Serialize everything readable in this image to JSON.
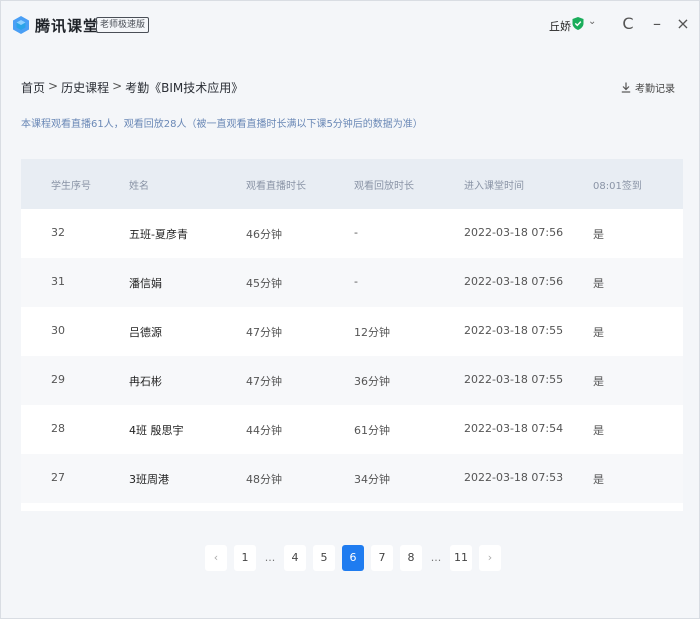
{
  "app": {
    "name": "腾讯课堂",
    "edition_badge": "老师极速版",
    "user_name": "丘娇",
    "user_chevron": "⌄",
    "refresh_glyph": "C",
    "minimize_glyph": "–",
    "close_glyph": "×"
  },
  "breadcrumb": {
    "items": [
      "首页",
      "历史课程",
      "考勤《BIM技术应用》"
    ],
    "separator": ">"
  },
  "export_label": "考勤记录",
  "summary": "本课程观看直播61人，观看回放28人（被一直观看直播时长满以下课5分钟后的数据为准）",
  "table": {
    "columns": [
      "学生序号",
      "姓名",
      "观看直播时长",
      "观看回放时长",
      "进入课堂时间",
      "08:01签到"
    ],
    "rows": [
      {
        "id": "32",
        "name": "五班-夏彦青",
        "live": "46分钟",
        "replay": "-",
        "enter": "2022-03-18 07:56",
        "signed": "是"
      },
      {
        "id": "31",
        "name": "潘信娟",
        "live": "45分钟",
        "replay": "-",
        "enter": "2022-03-18 07:56",
        "signed": "是"
      },
      {
        "id": "30",
        "name": "吕德源",
        "live": "47分钟",
        "replay": "12分钟",
        "enter": "2022-03-18 07:55",
        "signed": "是"
      },
      {
        "id": "29",
        "name": "冉石彬",
        "live": "47分钟",
        "replay": "36分钟",
        "enter": "2022-03-18 07:55",
        "signed": "是"
      },
      {
        "id": "28",
        "name": "4班 殷思宇",
        "live": "44分钟",
        "replay": "61分钟",
        "enter": "2022-03-18 07:54",
        "signed": "是"
      },
      {
        "id": "27",
        "name": "3班周港",
        "live": "48分钟",
        "replay": "34分钟",
        "enter": "2022-03-18 07:53",
        "signed": "是"
      }
    ]
  },
  "pagination": {
    "prev": "‹",
    "next": "›",
    "pages": [
      "1",
      "...",
      "4",
      "5",
      "6",
      "7",
      "8",
      "...",
      "11"
    ],
    "current": "6"
  },
  "colors": {
    "accent": "#1f7cf0",
    "summary_text": "#6a88b6",
    "verified_green": "#1aad5b"
  }
}
